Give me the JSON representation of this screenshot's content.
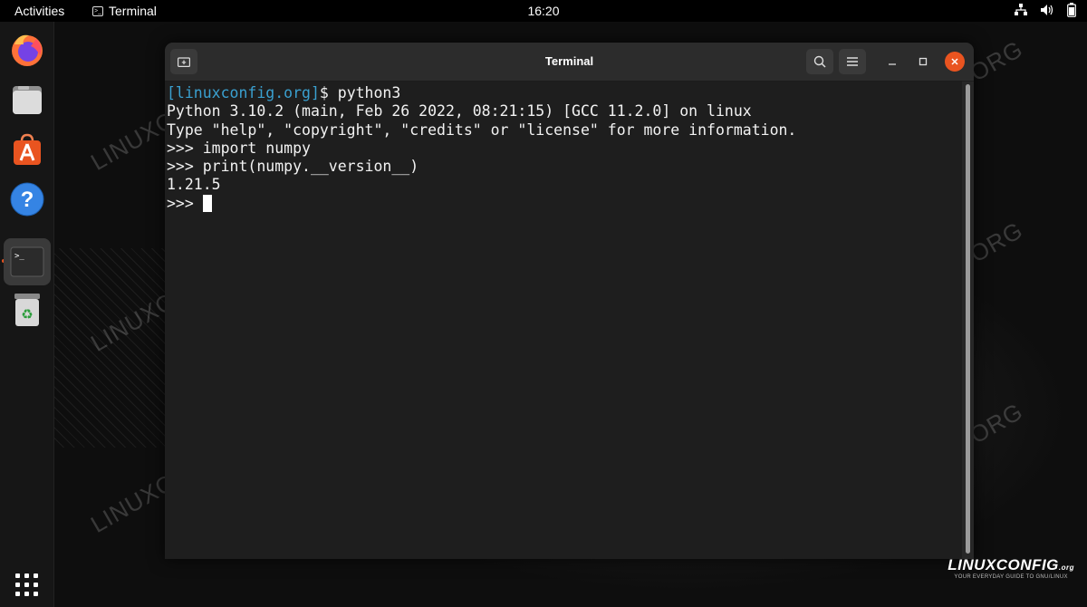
{
  "topbar": {
    "activities": "Activities",
    "app_name": "Terminal",
    "clock": "16:20",
    "tray_icons": [
      "network-icon",
      "volume-icon",
      "battery-icon"
    ]
  },
  "dock": {
    "items": [
      "firefox",
      "files",
      "ubuntu-software",
      "help",
      "terminal",
      "trash"
    ],
    "active": "terminal",
    "show_apps": "show-applications-icon"
  },
  "window": {
    "title": "Terminal",
    "lines": [
      {
        "host": "[linuxconfig.org]",
        "text": "$ python3"
      },
      {
        "text": "Python 3.10.2 (main, Feb 26 2022, 08:21:15) [GCC 11.2.0] on linux"
      },
      {
        "text": "Type \"help\", \"copyright\", \"credits\" or \"license\" for more information."
      },
      {
        "text": ">>> import numpy"
      },
      {
        "text": ">>> print(numpy.__version__)"
      },
      {
        "text": "1.21.5"
      },
      {
        "text": ">>> "
      }
    ]
  },
  "watermark": "LINUXCONFIG.ORG",
  "logo": {
    "brand": "LINUXCONFIG",
    "suffix": ".org",
    "tagline": "YOUR EVERYDAY GUIDE TO GNU/LINUX"
  },
  "colors": {
    "accent": "#e95420",
    "prompt_host": "#3aa0d0",
    "terminal_bg": "#1c1c1c"
  }
}
